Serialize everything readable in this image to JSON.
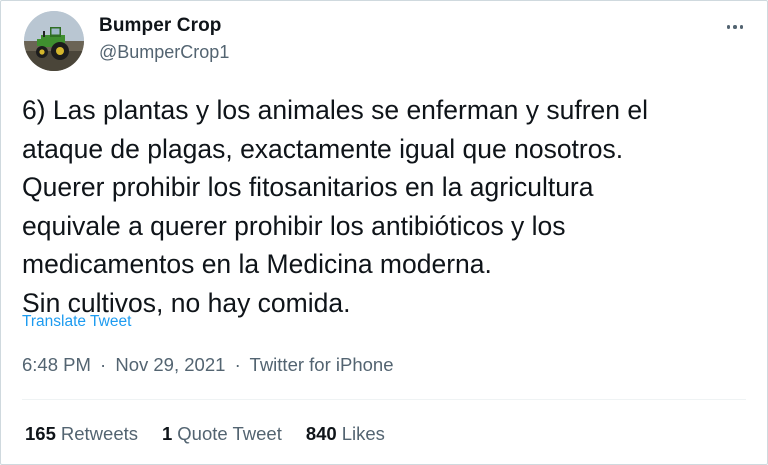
{
  "user": {
    "display_name": "Bumper Crop",
    "handle": "@BumperCrop1",
    "avatar_icon": "tractor-avatar"
  },
  "more_icon": "more-options-icon",
  "tweet": {
    "lines": [
      "6) Las plantas y los animales se enferman y sufren el",
      "ataque de plagas, exactamente igual que nosotros.",
      "Querer prohibir los fitosanitarios en la agricultura",
      "equivale a querer prohibir los antibióticos y los",
      "medicamentos en la Medicina moderna.",
      "Sin cultivos, no hay comida."
    ],
    "translate_label": "Translate Tweet"
  },
  "meta": {
    "time": "6:48 PM",
    "separator": "·",
    "date": "Nov 29, 2021",
    "source": "Twitter for iPhone"
  },
  "stats": {
    "retweets_count": "165",
    "retweets_label": "Retweets",
    "quotes_count": "1",
    "quotes_label": "Quote Tweet",
    "likes_count": "840",
    "likes_label": "Likes"
  },
  "colors": {
    "link": "#1d9bf0",
    "secondary_text": "#536471",
    "primary_text": "#0f1419",
    "tractor_green": "#3f8f2f"
  }
}
